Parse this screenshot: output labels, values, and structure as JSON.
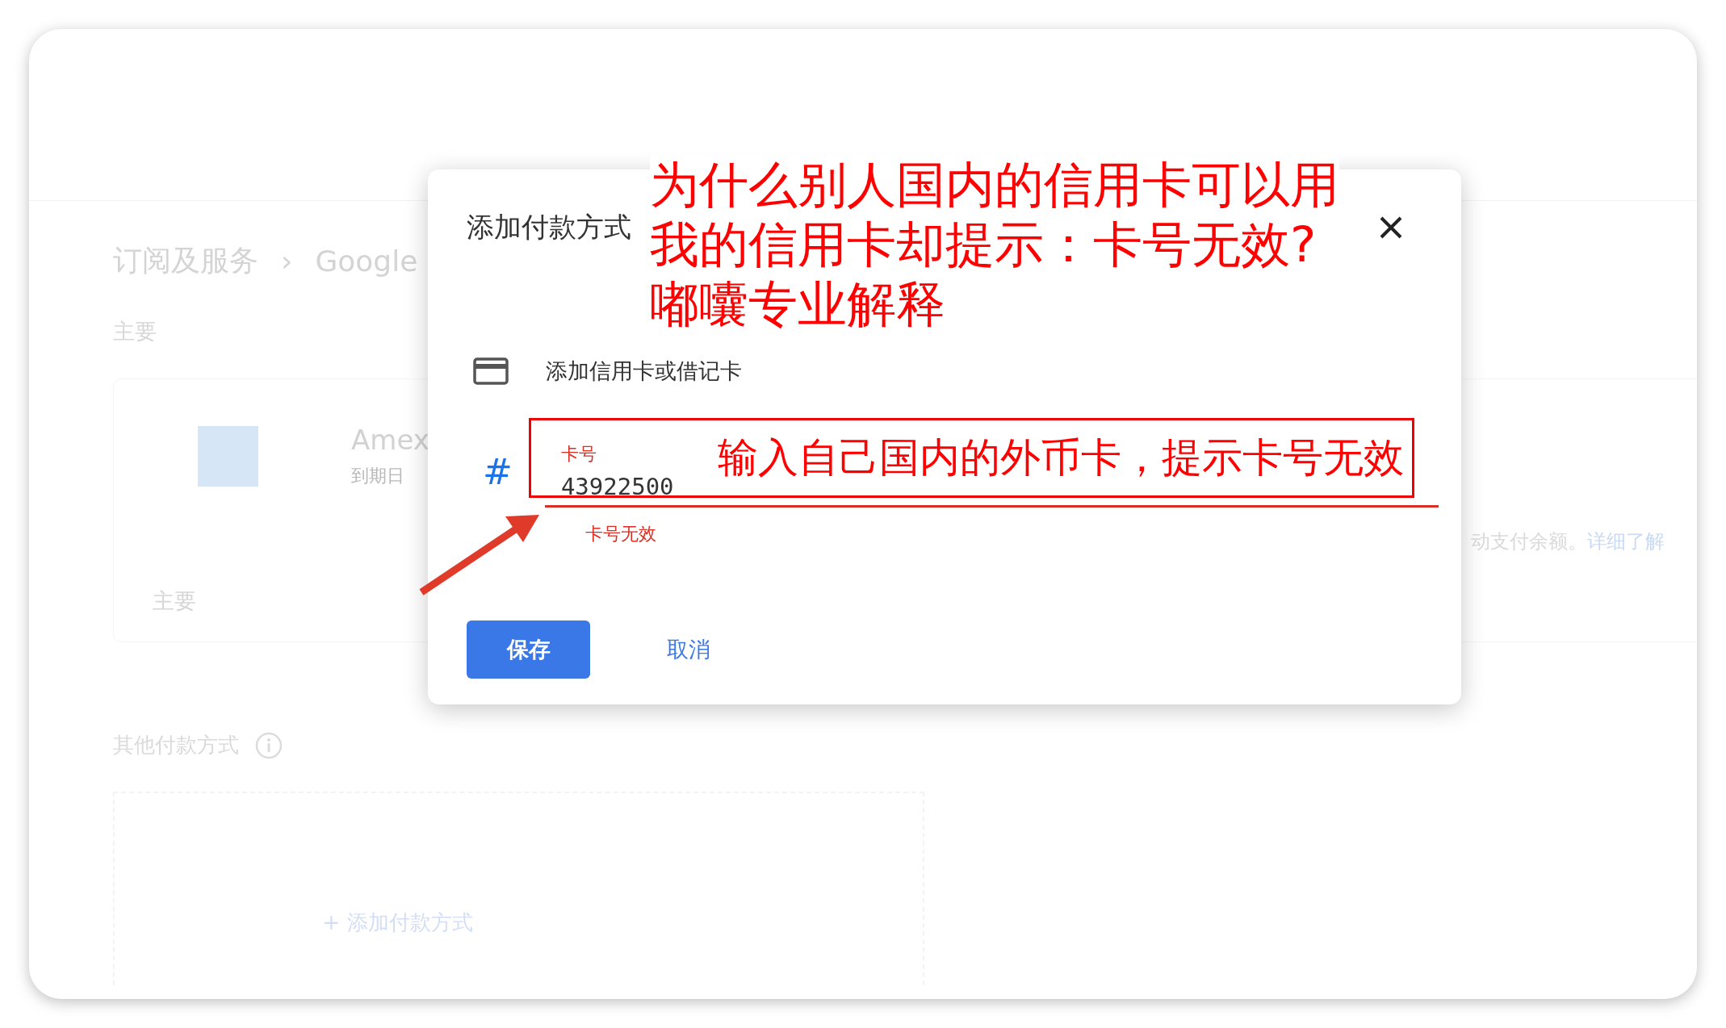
{
  "background_page": {
    "breadcrumb": [
      "订阅及服务",
      "›",
      "Google"
    ],
    "primary_heading": "主要",
    "primary_card": {
      "name": "Amex",
      "expiry": "到期日",
      "note": "动支付余额。",
      "note_link": "详细了解",
      "badge": "主要"
    },
    "other_heading": "其他付款方式",
    "add_method": "+ 添加付款方式"
  },
  "dialog": {
    "title": "添加付款方式",
    "option": "添加信用卡或借记卡",
    "card_field": {
      "icon": "#",
      "label": "卡号",
      "value": "43922500",
      "error": "卡号无效",
      "invalid": true
    },
    "buttons": [
      {
        "label": "保存",
        "kind": "primary"
      },
      {
        "label": "取消",
        "kind": "text"
      }
    ]
  },
  "annotations": {
    "question_lines": [
      "为什么别人国内的信用卡可以用",
      "我的信用卡却提示：卡号无效?",
      "嘟囔专业解释"
    ],
    "field_note": "输入自己国内的外币卡，提示卡号无效"
  }
}
